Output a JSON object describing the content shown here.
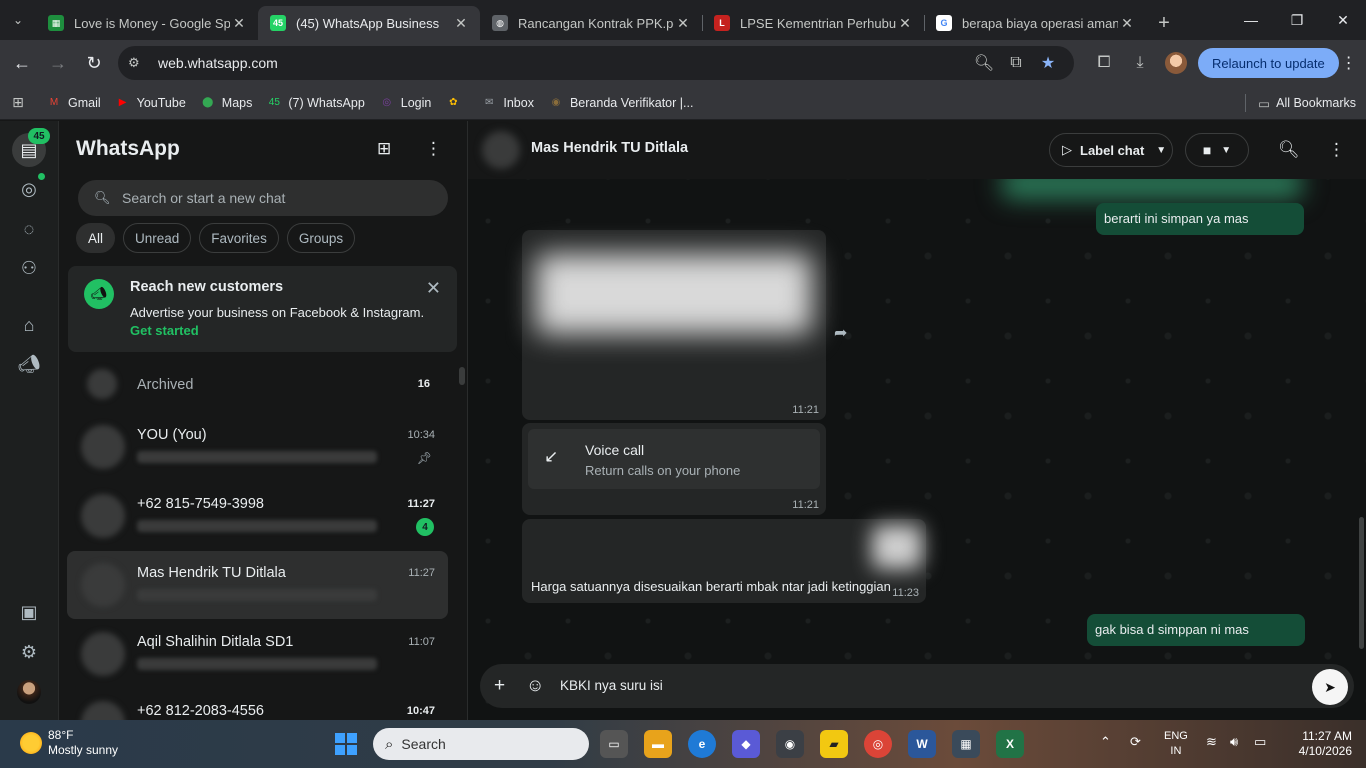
{
  "browser": {
    "tabs": [
      {
        "title": "Love is Money - Google Spre",
        "fav": "sheets",
        "color": "#1e8e3e",
        "glyph": "▦"
      },
      {
        "title": "(45) WhatsApp Business",
        "fav": "whatsapp",
        "color": "#25d366",
        "glyph": "45"
      },
      {
        "title": "Rancangan Kontrak PPK.pdf",
        "fav": "globe",
        "color": "#5f6368",
        "glyph": "◍"
      },
      {
        "title": "LPSE Kementrian Perhubung",
        "fav": "lpse",
        "color": "#c5221f",
        "glyph": "L"
      },
      {
        "title": "berapa biaya operasi amand",
        "fav": "google",
        "color": "#ffffff",
        "glyph": "G"
      }
    ],
    "active_tab": 1,
    "url": "web.whatsapp.com",
    "relaunch_label": "Relaunch to update",
    "bookmarks": [
      {
        "label": "Gmail",
        "icon": "gmail-icon",
        "color": "#ea4335",
        "glyph": "M"
      },
      {
        "label": "YouTube",
        "icon": "youtube-icon",
        "color": "#ff0000",
        "glyph": "▶"
      },
      {
        "label": "Maps",
        "icon": "maps-icon",
        "color": "#34a853",
        "glyph": "⬤"
      },
      {
        "label": "(7) WhatsApp",
        "icon": "whatsapp-icon",
        "color": "#25d366",
        "glyph": "45"
      },
      {
        "label": "Login",
        "icon": "login-icon",
        "color": "#7b3fa0",
        "glyph": "◎"
      },
      {
        "label": "",
        "icon": "photos-icon",
        "color": "#fbbc04",
        "glyph": "✿"
      },
      {
        "label": "Inbox",
        "icon": "mail-icon",
        "color": "#9aa0a6",
        "glyph": "✉"
      },
      {
        "label": "Beranda Verifikator |...",
        "icon": "verifikator-icon",
        "color": "#8a6d3b",
        "glyph": "◉"
      }
    ],
    "all_bookmarks": "All Bookmarks"
  },
  "rail": {
    "chats_badge": "45"
  },
  "sidebar": {
    "title": "WhatsApp",
    "search_placeholder": "Search or start a new chat",
    "filters": [
      "All",
      "Unread",
      "Favorites",
      "Groups"
    ],
    "promo": {
      "title": "Reach new customers",
      "desc": "Advertise your business on Facebook & Instagram.",
      "link": "Get started"
    },
    "archived_label": "Archived",
    "archived_count": "16",
    "chats": [
      {
        "name": "YOU (You)",
        "time": "10:34",
        "bold": false,
        "unread": "",
        "pinned": true
      },
      {
        "name": "+62 815-7549-3998",
        "time": "11:27",
        "bold": true,
        "unread": "4",
        "pinned": false
      },
      {
        "name": "Mas Hendrik TU Ditlala",
        "time": "11:27",
        "bold": false,
        "unread": "",
        "pinned": false,
        "selected": true
      },
      {
        "name": "Aqil Shalihin Ditlala SD1",
        "time": "11:07",
        "bold": false,
        "unread": "",
        "pinned": false
      },
      {
        "name": "+62 812-2083-4556",
        "time": "10:47",
        "bold": true,
        "unread": "",
        "pinned": false
      }
    ]
  },
  "chat": {
    "contact": "Mas Hendrik TU Ditlala",
    "label_chat": "Label chat",
    "messages": {
      "out1_text": "berarti ini simpan ya mas",
      "media_time": "11:21",
      "voice_title": "Voice call",
      "voice_sub": "Return calls on your phone",
      "voice_time": "11:21",
      "in_text": "Harga satuannya disesuaikan berarti mbak ntar jadi ketinggian",
      "in_time": "11:23",
      "out2_text": "gak bisa d simppan ni mas"
    },
    "composer_text": "KBKI nya suru isi"
  },
  "taskbar": {
    "temp": "88°F",
    "weather": "Mostly sunny",
    "search_label": "Search",
    "lang1": "ENG",
    "lang2": "IN",
    "time": "11:27 AM",
    "date": "4/10/2026"
  }
}
